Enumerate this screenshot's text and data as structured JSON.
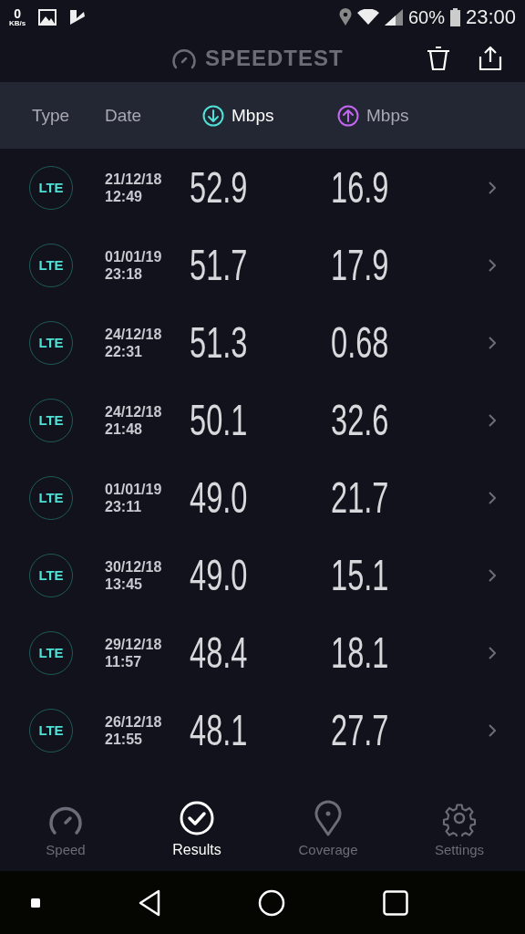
{
  "status_bar": {
    "net_speed": "0",
    "net_unit": "KB/s",
    "battery": "60%",
    "time": "23:00"
  },
  "app_header": {
    "title": "SPEEDTEST"
  },
  "columns": [
    {
      "label": "Type",
      "kind": "text",
      "selected": false
    },
    {
      "label": "Date",
      "kind": "text",
      "selected": false
    },
    {
      "label": "Mbps",
      "kind": "download",
      "selected": true
    },
    {
      "label": "Mbps",
      "kind": "upload",
      "selected": false
    }
  ],
  "results": [
    {
      "type": "LTE",
      "date": "21/12/18",
      "time": "12:49",
      "download": "52.9",
      "upload": "16.9"
    },
    {
      "type": "LTE",
      "date": "01/01/19",
      "time": "23:18",
      "download": "51.7",
      "upload": "17.9"
    },
    {
      "type": "LTE",
      "date": "24/12/18",
      "time": "22:31",
      "download": "51.3",
      "upload": "0.68"
    },
    {
      "type": "LTE",
      "date": "24/12/18",
      "time": "21:48",
      "download": "50.1",
      "upload": "32.6"
    },
    {
      "type": "LTE",
      "date": "01/01/19",
      "time": "23:11",
      "download": "49.0",
      "upload": "21.7"
    },
    {
      "type": "LTE",
      "date": "30/12/18",
      "time": "13:45",
      "download": "49.0",
      "upload": "15.1"
    },
    {
      "type": "LTE",
      "date": "29/12/18",
      "time": "11:57",
      "download": "48.4",
      "upload": "18.1"
    },
    {
      "type": "LTE",
      "date": "26/12/18",
      "time": "21:55",
      "download": "48.1",
      "upload": "27.7"
    }
  ],
  "bottom_nav": [
    {
      "label": "Speed",
      "kind": "gauge",
      "selected": false
    },
    {
      "label": "Results",
      "kind": "check",
      "selected": true
    },
    {
      "label": "Coverage",
      "kind": "pin",
      "selected": false
    },
    {
      "label": "Settings",
      "kind": "gear",
      "selected": false
    }
  ]
}
